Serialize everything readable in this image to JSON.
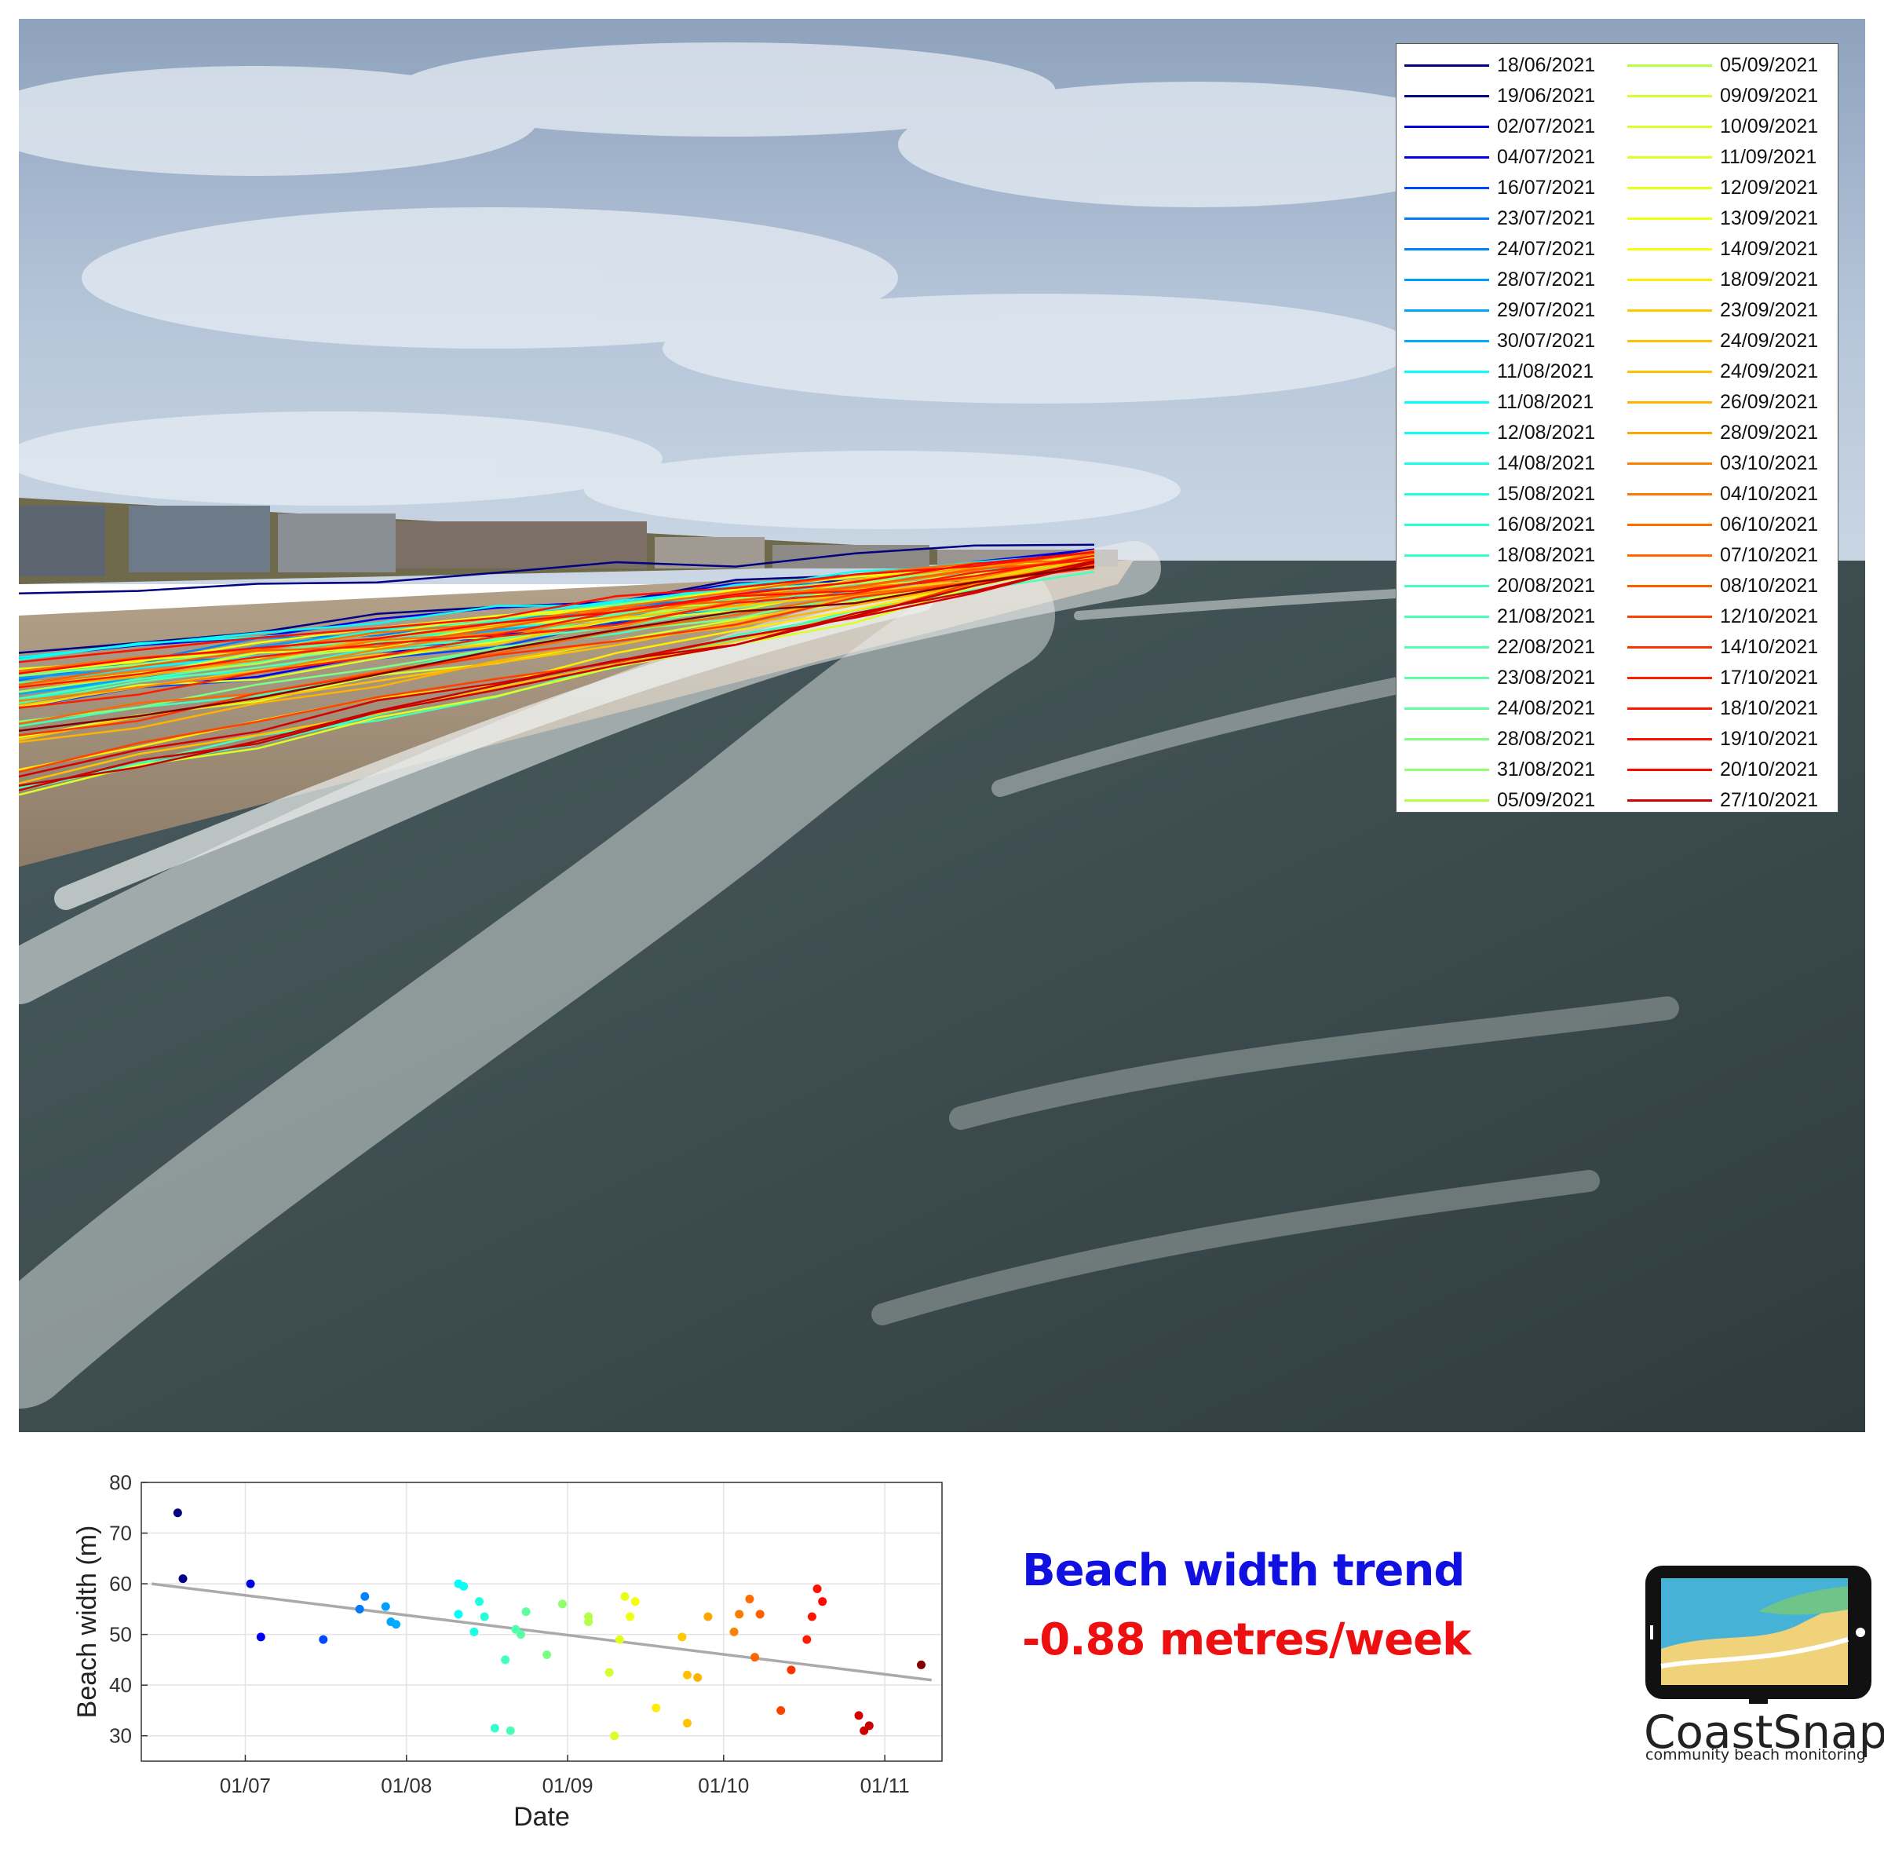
{
  "photo": {
    "scene": "beach-oblique-photo"
  },
  "legend": {
    "entries": [
      "18/06/2021",
      "19/06/2021",
      "02/07/2021",
      "04/07/2021",
      "16/07/2021",
      "23/07/2021",
      "24/07/2021",
      "28/07/2021",
      "29/07/2021",
      "30/07/2021",
      "11/08/2021",
      "11/08/2021",
      "12/08/2021",
      "14/08/2021",
      "15/08/2021",
      "16/08/2021",
      "18/08/2021",
      "20/08/2021",
      "21/08/2021",
      "22/08/2021",
      "23/08/2021",
      "24/08/2021",
      "28/08/2021",
      "31/08/2021",
      "05/09/2021",
      "05/09/2021",
      "09/09/2021",
      "10/09/2021",
      "11/09/2021",
      "12/09/2021",
      "13/09/2021",
      "14/09/2021",
      "18/09/2021",
      "23/09/2021",
      "24/09/2021",
      "24/09/2021",
      "26/09/2021",
      "28/09/2021",
      "03/10/2021",
      "04/10/2021",
      "06/10/2021",
      "07/10/2021",
      "08/10/2021",
      "12/10/2021",
      "14/10/2021",
      "17/10/2021",
      "18/10/2021",
      "19/10/2021",
      "20/10/2021",
      "27/10/2021"
    ]
  },
  "chart_data": {
    "type": "scatter",
    "title": "",
    "xlabel": "Date",
    "ylabel": "Beach width (m)",
    "x_tick_labels": [
      "01/07",
      "01/08",
      "01/09",
      "01/10",
      "01/11"
    ],
    "x_tick_dates": [
      "2021-07-01",
      "2021-08-01",
      "2021-09-01",
      "2021-10-01",
      "2021-11-01"
    ],
    "xlim": [
      "2021-06-11",
      "2021-11-12"
    ],
    "ylim": [
      25,
      80
    ],
    "y_ticks": [
      30,
      40,
      50,
      60,
      70,
      80
    ],
    "grid": true,
    "points": [
      {
        "date": "2021-06-18",
        "y": 74
      },
      {
        "date": "2021-06-19",
        "y": 61
      },
      {
        "date": "2021-07-02",
        "y": 60
      },
      {
        "date": "2021-07-04",
        "y": 49.5
      },
      {
        "date": "2021-07-16",
        "y": 49
      },
      {
        "date": "2021-07-23",
        "y": 55
      },
      {
        "date": "2021-07-24",
        "y": 57.5
      },
      {
        "date": "2021-07-28",
        "y": 55.5
      },
      {
        "date": "2021-07-29",
        "y": 52.5
      },
      {
        "date": "2021-07-30",
        "y": 52
      },
      {
        "date": "2021-08-11",
        "y": 60
      },
      {
        "date": "2021-08-11",
        "y": 54
      },
      {
        "date": "2021-08-12",
        "y": 59.5
      },
      {
        "date": "2021-08-14",
        "y": 50.5
      },
      {
        "date": "2021-08-15",
        "y": 56.5
      },
      {
        "date": "2021-08-16",
        "y": 53.5
      },
      {
        "date": "2021-08-18",
        "y": 31.5
      },
      {
        "date": "2021-08-20",
        "y": 45
      },
      {
        "date": "2021-08-21",
        "y": 31
      },
      {
        "date": "2021-08-22",
        "y": 51
      },
      {
        "date": "2021-08-23",
        "y": 50
      },
      {
        "date": "2021-08-24",
        "y": 54.5
      },
      {
        "date": "2021-08-28",
        "y": 46
      },
      {
        "date": "2021-08-31",
        "y": 56
      },
      {
        "date": "2021-09-05",
        "y": 53.5
      },
      {
        "date": "2021-09-05",
        "y": 52.5
      },
      {
        "date": "2021-09-09",
        "y": 42.5
      },
      {
        "date": "2021-09-10",
        "y": 30
      },
      {
        "date": "2021-09-11",
        "y": 49
      },
      {
        "date": "2021-09-12",
        "y": 57.5
      },
      {
        "date": "2021-09-13",
        "y": 53.5
      },
      {
        "date": "2021-09-14",
        "y": 56.5
      },
      {
        "date": "2021-09-18",
        "y": 35.5
      },
      {
        "date": "2021-09-23",
        "y": 49.5
      },
      {
        "date": "2021-09-24",
        "y": 42
      },
      {
        "date": "2021-09-24",
        "y": 32.5
      },
      {
        "date": "2021-09-26",
        "y": 41.5
      },
      {
        "date": "2021-09-28",
        "y": 53.5
      },
      {
        "date": "2021-10-03",
        "y": 50.5
      },
      {
        "date": "2021-10-04",
        "y": 54
      },
      {
        "date": "2021-10-06",
        "y": 57
      },
      {
        "date": "2021-10-07",
        "y": 45.5
      },
      {
        "date": "2021-10-08",
        "y": 54
      },
      {
        "date": "2021-10-12",
        "y": 35
      },
      {
        "date": "2021-10-14",
        "y": 43
      },
      {
        "date": "2021-10-17",
        "y": 49
      },
      {
        "date": "2021-10-18",
        "y": 53.5
      },
      {
        "date": "2021-10-19",
        "y": 59
      },
      {
        "date": "2021-10-20",
        "y": 56.5
      },
      {
        "date": "2021-10-27",
        "y": 34
      },
      {
        "date": "2021-10-28",
        "y": 31
      },
      {
        "date": "2021-10-29",
        "y": 32
      },
      {
        "date": "2021-11-08",
        "y": 44
      }
    ],
    "trend": {
      "start": {
        "date": "2021-06-13",
        "y": 60
      },
      "end": {
        "date": "2021-11-10",
        "y": 41
      },
      "color": "#aaaaaa"
    }
  },
  "trend_text": {
    "title": "Beach width trend",
    "value": "-0.88 metres/week",
    "title_color": "#1010e0",
    "value_color": "#ee1010"
  },
  "logo": {
    "name": "CoastSnap",
    "tagline": "community beach monitoring"
  }
}
